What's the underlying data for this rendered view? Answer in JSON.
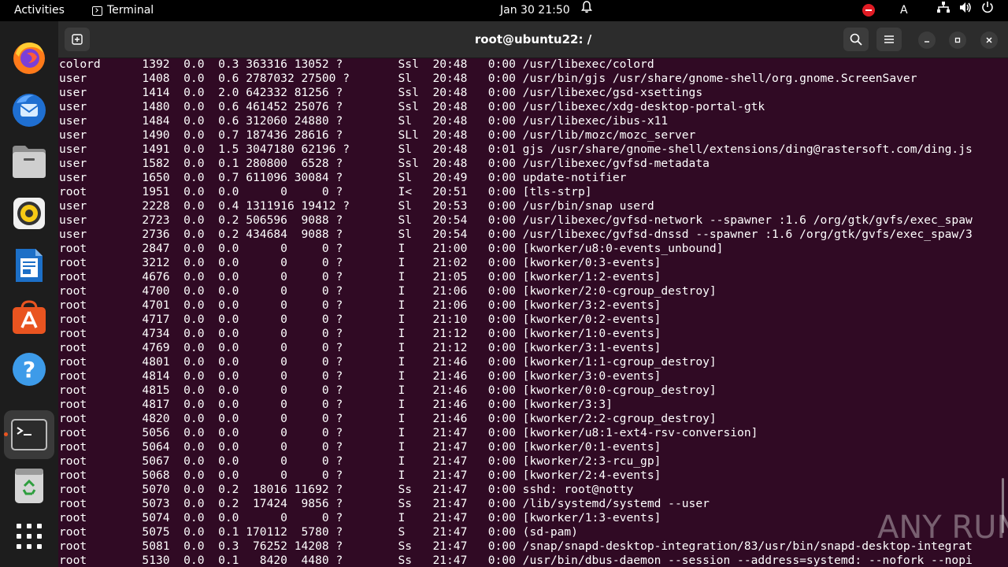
{
  "topbar": {
    "activities": "Activities",
    "app_name": "Terminal",
    "clock": "Jan 30  21:50",
    "keyboard_layout": "A"
  },
  "window": {
    "title": "root@ubuntu22: /"
  },
  "dock": {
    "apps": [
      "Firefox",
      "Thunderbird",
      "Files",
      "Rhythmbox",
      "LibreOffice Writer",
      "Ubuntu Software",
      "Help",
      "Terminal",
      "Trash",
      "Show Applications"
    ]
  },
  "watermark": "ANY RUN",
  "terminal_lines": [
    "colord      1392  0.0  0.3 363316 13052 ?        Ssl  20:48   0:00 /usr/libexec/colord",
    "user        1408  0.0  0.6 2787032 27500 ?       Sl   20:48   0:00 /usr/bin/gjs /usr/share/gnome-shell/org.gnome.ScreenSaver",
    "user        1414  0.0  2.0 642332 81256 ?        Ssl  20:48   0:00 /usr/libexec/gsd-xsettings",
    "user        1480  0.0  0.6 461452 25076 ?        Ssl  20:48   0:00 /usr/libexec/xdg-desktop-portal-gtk",
    "user        1484  0.0  0.6 312060 24880 ?        Sl   20:48   0:00 /usr/libexec/ibus-x11",
    "user        1490  0.0  0.7 187436 28616 ?        SLl  20:48   0:00 /usr/lib/mozc/mozc_server",
    "user        1491  0.0  1.5 3047180 62196 ?       Sl   20:48   0:01 gjs /usr/share/gnome-shell/extensions/ding@rastersoft.com/ding.js",
    "user        1582  0.0  0.1 280800  6528 ?        Ssl  20:48   0:00 /usr/libexec/gvfsd-metadata",
    "user        1650  0.0  0.7 611096 30084 ?        Sl   20:49   0:00 update-notifier",
    "root        1951  0.0  0.0      0     0 ?        I<   20:51   0:00 [tls-strp]",
    "user        2228  0.0  0.4 1311916 19412 ?       Sl   20:53   0:00 /usr/bin/snap userd",
    "user        2723  0.0  0.2 506596  9088 ?        Sl   20:54   0:00 /usr/libexec/gvfsd-network --spawner :1.6 /org/gtk/gvfs/exec_spaw",
    "user        2736  0.0  0.2 434684  9088 ?        Sl   20:54   0:00 /usr/libexec/gvfsd-dnssd --spawner :1.6 /org/gtk/gvfs/exec_spaw/3",
    "root        2847  0.0  0.0      0     0 ?        I    21:00   0:00 [kworker/u8:0-events_unbound]",
    "root        3212  0.0  0.0      0     0 ?        I    21:02   0:00 [kworker/0:3-events]",
    "root        4676  0.0  0.0      0     0 ?        I    21:05   0:00 [kworker/1:2-events]",
    "root        4700  0.0  0.0      0     0 ?        I    21:06   0:00 [kworker/2:0-cgroup_destroy]",
    "root        4701  0.0  0.0      0     0 ?        I    21:06   0:00 [kworker/3:2-events]",
    "root        4717  0.0  0.0      0     0 ?        I    21:10   0:00 [kworker/0:2-events]",
    "root        4734  0.0  0.0      0     0 ?        I    21:12   0:00 [kworker/1:0-events]",
    "root        4769  0.0  0.0      0     0 ?        I    21:12   0:00 [kworker/3:1-events]",
    "root        4801  0.0  0.0      0     0 ?        I    21:46   0:00 [kworker/1:1-cgroup_destroy]",
    "root        4814  0.0  0.0      0     0 ?        I    21:46   0:00 [kworker/3:0-events]",
    "root        4815  0.0  0.0      0     0 ?        I    21:46   0:00 [kworker/0:0-cgroup_destroy]",
    "root        4817  0.0  0.0      0     0 ?        I    21:46   0:00 [kworker/3:3]",
    "root        4820  0.0  0.0      0     0 ?        I    21:46   0:00 [kworker/2:2-cgroup_destroy]",
    "root        5056  0.0  0.0      0     0 ?        I    21:47   0:00 [kworker/u8:1-ext4-rsv-conversion]",
    "root        5064  0.0  0.0      0     0 ?        I    21:47   0:00 [kworker/0:1-events]",
    "root        5067  0.0  0.0      0     0 ?        I    21:47   0:00 [kworker/2:3-rcu_gp]",
    "root        5068  0.0  0.0      0     0 ?        I    21:47   0:00 [kworker/2:4-events]",
    "root        5070  0.0  0.2  18016 11692 ?        Ss   21:47   0:00 sshd: root@notty",
    "root        5073  0.0  0.2  17424  9856 ?        Ss   21:47   0:00 /lib/systemd/systemd --user",
    "root        5074  0.0  0.0      0     0 ?        I    21:47   0:00 [kworker/1:3-events]",
    "root        5075  0.0  0.1 170112  5780 ?        S    21:47   0:00 (sd-pam)",
    "root        5081  0.0  0.3  76252 14208 ?        Ss   21:47   0:00 /snap/snapd-desktop-integration/83/usr/bin/snapd-desktop-integrat",
    "root        5130  0.0  0.1   8420  4480 ?        Ss   21:47   0:00 /usr/bin/dbus-daemon --session --address=systemd: --nofork --nopi"
  ]
}
